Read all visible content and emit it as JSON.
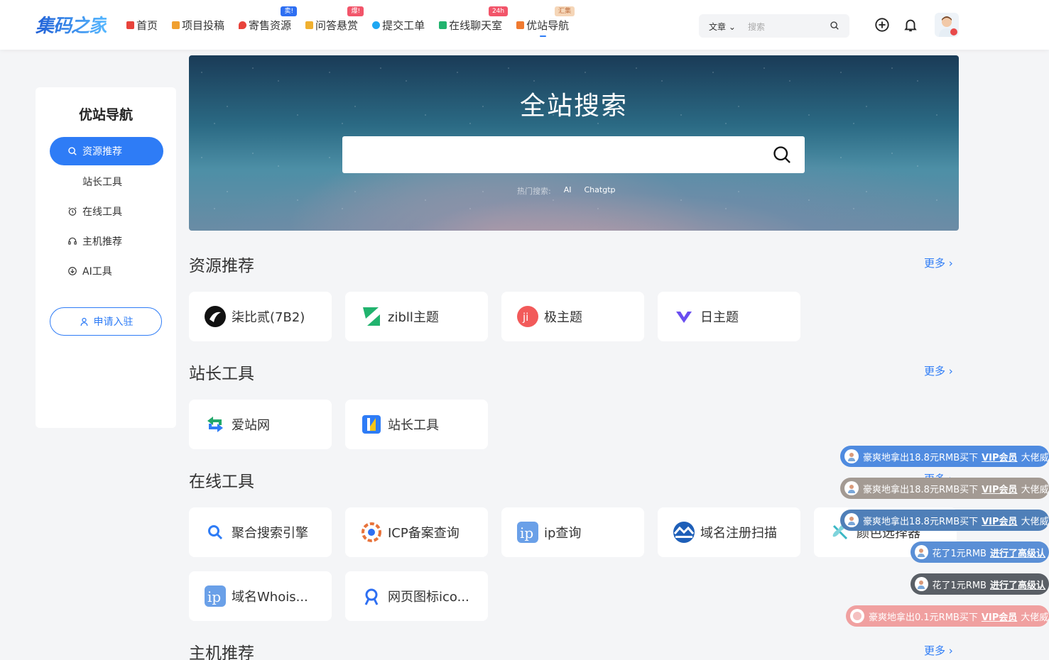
{
  "header": {
    "logo": "集码之家",
    "nav": [
      {
        "label": "首页",
        "color": "#e8433b",
        "badge": "",
        "badge_color": ""
      },
      {
        "label": "项目投稿",
        "color": "#f0a030",
        "badge": "",
        "badge_color": ""
      },
      {
        "label": "寄售资源",
        "color": "#e8433b",
        "badge": "卖!",
        "badge_color": "#2e6ff2"
      },
      {
        "label": "问答悬赏",
        "color": "#f0b030",
        "badge": "爆!",
        "badge_color": "#f2556a"
      },
      {
        "label": "提交工单",
        "color": "#1ea7f2",
        "badge": "",
        "badge_color": ""
      },
      {
        "label": "在线聊天室",
        "color": "#21b36e",
        "badge": "24h",
        "badge_color": "#f2556a"
      },
      {
        "label": "优站导航",
        "color": "#f07a30",
        "badge": "汇集",
        "badge_color": "#f5d6b8"
      }
    ],
    "search_type": "文章",
    "search_placeholder": "搜索"
  },
  "sidebar": {
    "title": "优站导航",
    "items": [
      {
        "label": "资源推荐",
        "icon": "search-icon"
      },
      {
        "label": "站长工具",
        "icon": ""
      },
      {
        "label": "在线工具",
        "icon": "alarm-icon"
      },
      {
        "label": "主机推荐",
        "icon": "headset-icon"
      },
      {
        "label": "AI工具",
        "icon": "download-icon"
      }
    ],
    "apply_label": "申请入驻"
  },
  "banner": {
    "title": "全站搜索",
    "hot_label": "热门搜索:",
    "hot_keywords": [
      "AI",
      "Chatgtp"
    ]
  },
  "sections": [
    {
      "title": "资源推荐",
      "more": "更多 ›",
      "cards": [
        "柒比贰(7B2)",
        "zibll主题",
        "极主题",
        "日主题"
      ]
    },
    {
      "title": "站长工具",
      "more": "更多 ›",
      "cards": [
        "爱站网",
        "站长工具"
      ]
    },
    {
      "title": "在线工具",
      "more": "更多 ›",
      "cards": [
        "聚合搜索引擎",
        "ICP备案查询",
        "ip查询",
        "域名注册扫描",
        "颜色选择器",
        "域名Whois...",
        "网页图标ico..."
      ]
    },
    {
      "title": "主机推荐",
      "more": "更多 ›",
      "cards": []
    }
  ],
  "toasts": [
    {
      "pre": "豪爽地拿出18.8元RMB买下",
      "vip": "VIP会员",
      "post": "大佬威",
      "color": "#4f8be0"
    },
    {
      "pre": "豪爽地拿出18.8元RMB买下",
      "vip": "VIP会员",
      "post": "大佬威",
      "color": "#a39a93"
    },
    {
      "pre": "豪爽地拿出18.8元RMB买下",
      "vip": "VIP会员",
      "post": "大佬威",
      "color": "#4f7fb8"
    },
    {
      "pre": "花了1元RMB",
      "vip": "进行了高级认",
      "post": "",
      "color": "#5a8fd6"
    },
    {
      "pre": "花了1元RMB",
      "vip": "进行了高级认",
      "post": "",
      "color": "#5a5f66"
    },
    {
      "pre": "豪爽地拿出0.1元RMB买下",
      "vip": "VIP会员",
      "post": "大佬威",
      "color": "#f0a0a0"
    }
  ]
}
